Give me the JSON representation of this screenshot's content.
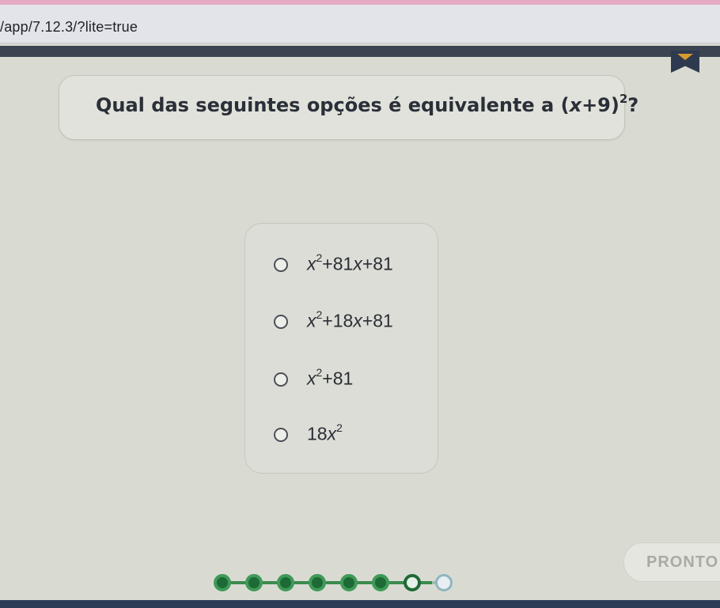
{
  "browser": {
    "url": "/app/7.12.3/?lite=true"
  },
  "question": {
    "prefix": "Qual das seguintes opções é equivalente a ",
    "expression_open": "(",
    "expression_var": "x",
    "expression_rest": "+9)",
    "expression_exp": "2",
    "suffix": "?"
  },
  "options": [
    {
      "var": "x",
      "exp": "2",
      "mid": "+81",
      "var2": "x",
      "tail": "+81"
    },
    {
      "var": "x",
      "exp": "2",
      "mid": "+18",
      "var2": "x",
      "tail": "+81"
    },
    {
      "var": "x",
      "exp": "2",
      "mid": "+81",
      "var2": "",
      "tail": ""
    },
    {
      "coef": "18",
      "var": "x",
      "exp": "2"
    }
  ],
  "ready_button": {
    "label": "PRONTO"
  },
  "progress": {
    "steps_total": 8,
    "steps_completed": 6,
    "current_step": 7
  },
  "colors": {
    "bookmark": "#2e3a4f",
    "progress_done": "#1e6a36",
    "progress_todo": "#8fb6c0",
    "ready_text_disabled": "#a8aba4"
  }
}
